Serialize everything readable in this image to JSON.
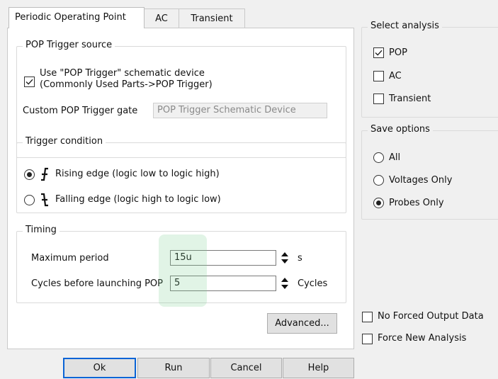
{
  "tabs": [
    {
      "label": "Periodic Operating Point",
      "active": true
    },
    {
      "label": "AC",
      "active": false
    },
    {
      "label": "Transient",
      "active": false
    }
  ],
  "pop_trigger_source": {
    "legend": "POP Trigger source",
    "use_device_label_line1": "Use \"POP Trigger\" schematic device",
    "use_device_label_line2": "(Commonly Used Parts->POP Trigger)",
    "use_device_checked": true,
    "custom_gate_label": "Custom POP Trigger gate",
    "custom_gate_value": "POP Trigger Schematic Device"
  },
  "trigger_condition": {
    "legend": "Trigger condition",
    "rising_label": "Rising edge (logic low to logic high)",
    "falling_label": "Falling edge (logic high to logic low)",
    "selected": "rising"
  },
  "timing": {
    "legend": "Timing",
    "max_period_label": "Maximum period",
    "max_period_value": "15u",
    "max_period_unit": "s",
    "cycles_label": "Cycles before launching POP",
    "cycles_value": "5",
    "cycles_unit": "Cycles"
  },
  "advanced_button": "Advanced...",
  "select_analysis": {
    "legend": "Select analysis",
    "items": [
      {
        "label": "POP",
        "checked": true
      },
      {
        "label": "AC",
        "checked": false
      },
      {
        "label": "Transient",
        "checked": false
      }
    ]
  },
  "save_options": {
    "legend": "Save options",
    "items": [
      {
        "label": "All",
        "selected": false
      },
      {
        "label": "Voltages Only",
        "selected": false
      },
      {
        "label": "Probes Only",
        "selected": true
      }
    ]
  },
  "no_forced_output": {
    "label": "No Forced Output Data",
    "checked": false
  },
  "force_new_analysis": {
    "label": "Force New Analysis",
    "checked": false
  },
  "buttons": {
    "ok": "Ok",
    "run": "Run",
    "cancel": "Cancel",
    "help": "Help"
  },
  "colors": {
    "accent": "#0a64d6",
    "highlight": "#78cd8c"
  }
}
